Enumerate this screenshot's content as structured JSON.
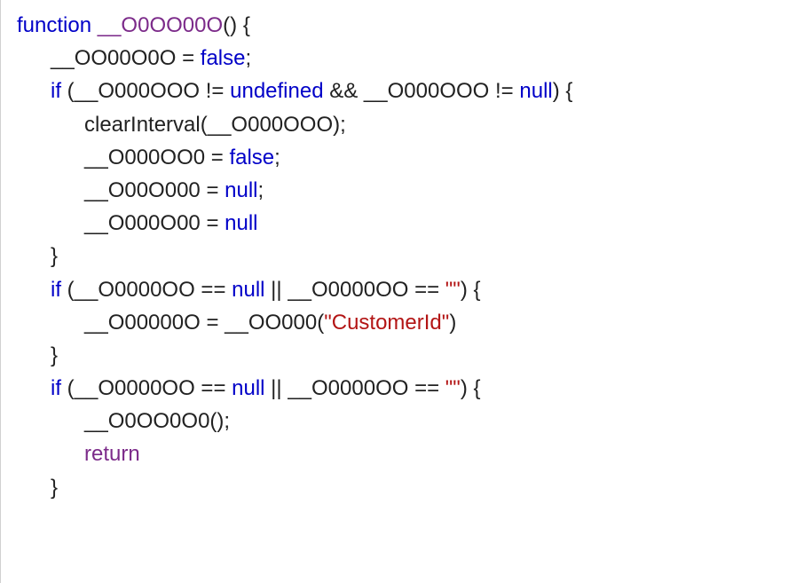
{
  "code": {
    "kw_function": "function",
    "fn_name": "__O0OO00O",
    "lparen": "(",
    "rparen": ")",
    "lbrace": "{",
    "rbrace": "}",
    "semi": ";",
    "eq": " = ",
    "assign": " = ",
    "v_OO00O0O": "__OO00O0O",
    "kw_false": "false",
    "kw_if": "if",
    "v_O000OOO": "__O000OOO",
    "neq": " != ",
    "kw_undefined": "undefined",
    "andand": " && ",
    "v_O000OOO_b": "__O000OOO",
    "kw_null": "null",
    "clearInterval": "clearInterval",
    "v_O000OO0": "__O000OO0",
    "v_O00O000": "__O00O000",
    "v_O000O00": "__O000O00",
    "v_O0000OO": "__O0000OO",
    "eqeq": " == ",
    "oror": " || ",
    "emptystr": "\"\"",
    "v_O00000O": "__O00000O",
    "fn_OO000": "__OO000",
    "str_customer": "\"CustomerId\"",
    "v_O0OO0O0": "__O0OO0O0",
    "kw_return": "return"
  }
}
